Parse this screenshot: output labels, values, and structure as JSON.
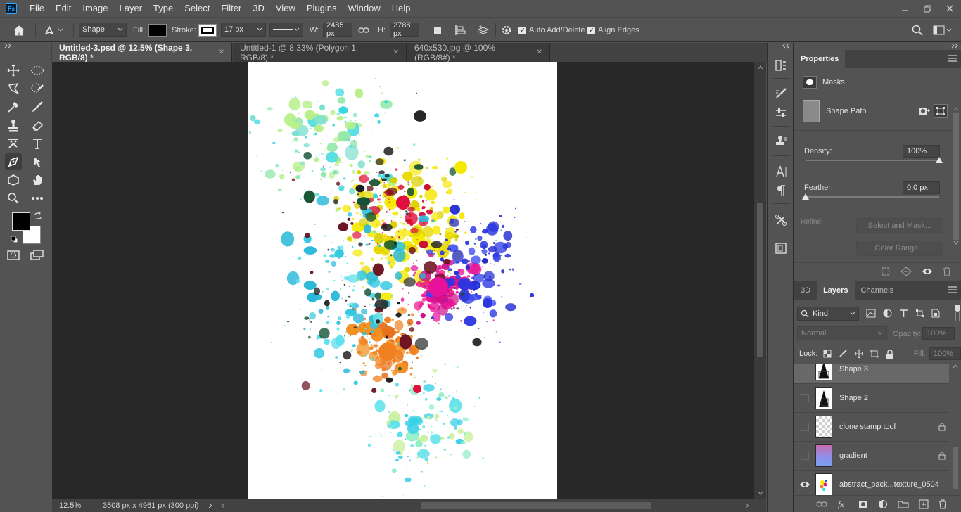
{
  "menubar": {
    "app_icon": "ps-logo",
    "logo_text": "Ps",
    "items": [
      "File",
      "Edit",
      "Image",
      "Layer",
      "Type",
      "Select",
      "Filter",
      "3D",
      "View",
      "Plugins",
      "Window",
      "Help"
    ],
    "window_controls": [
      "minimize",
      "restore",
      "close"
    ]
  },
  "options": {
    "tool_mode": "Shape",
    "fill_label": "Fill:",
    "fill_color": "#000000",
    "stroke_label": "Stroke:",
    "stroke_size": "17 px",
    "w_label": "W:",
    "w_value": "2485 px",
    "h_label": "H:",
    "h_value": "2788 px",
    "auto_add_delete": "Auto Add/Delete",
    "align_edges": "Align Edges"
  },
  "tabs": [
    {
      "label": "Untitled-3.psd @ 12.5% (Shape 3, RGB/8) *",
      "active": true
    },
    {
      "label": "Untitled-1 @ 8.33% (Polygon 1, RGB/8) *",
      "active": false
    },
    {
      "label": "640x530.jpg @ 100% (RGB/8#) *",
      "active": false
    }
  ],
  "toolbar": {
    "foreground_color": "#000000",
    "background_color": "#ffffff"
  },
  "status": {
    "zoom": "12.5%",
    "doc_info": "3508 px x 4961 px (300 ppi)"
  },
  "properties": {
    "title": "Properties",
    "masks_label": "Masks",
    "shape_path_label": "Shape Path",
    "density_label": "Density:",
    "density_value": "100%",
    "density": 1.0,
    "feather_label": "Feather:",
    "feather_value": "0.0 px",
    "feather": 0.0,
    "refine_label": "Refine:",
    "select_and_mask": "Select and Mask...",
    "color_range": "Color Range..."
  },
  "layers_panel": {
    "tabs": [
      "3D",
      "Layers",
      "Channels"
    ],
    "active_tab": "Layers",
    "filter_kind": "Kind",
    "blend_mode": "Normal",
    "opacity_label": "Opacity:",
    "opacity_value": "100%",
    "lock_label": "Lock:",
    "fill_label": "Fill:",
    "fill_value": "100%",
    "layers": [
      {
        "name": "Shape 3",
        "visible": false,
        "locked": false,
        "selected": true
      },
      {
        "name": "Shape 2",
        "visible": false,
        "locked": false,
        "selected": false
      },
      {
        "name": "clone stamp tool",
        "visible": false,
        "locked": true,
        "selected": false
      },
      {
        "name": "gradient",
        "visible": false,
        "locked": true,
        "selected": false
      },
      {
        "name": "abstract_back...texture_0504",
        "visible": true,
        "locked": false,
        "selected": false
      }
    ]
  }
}
